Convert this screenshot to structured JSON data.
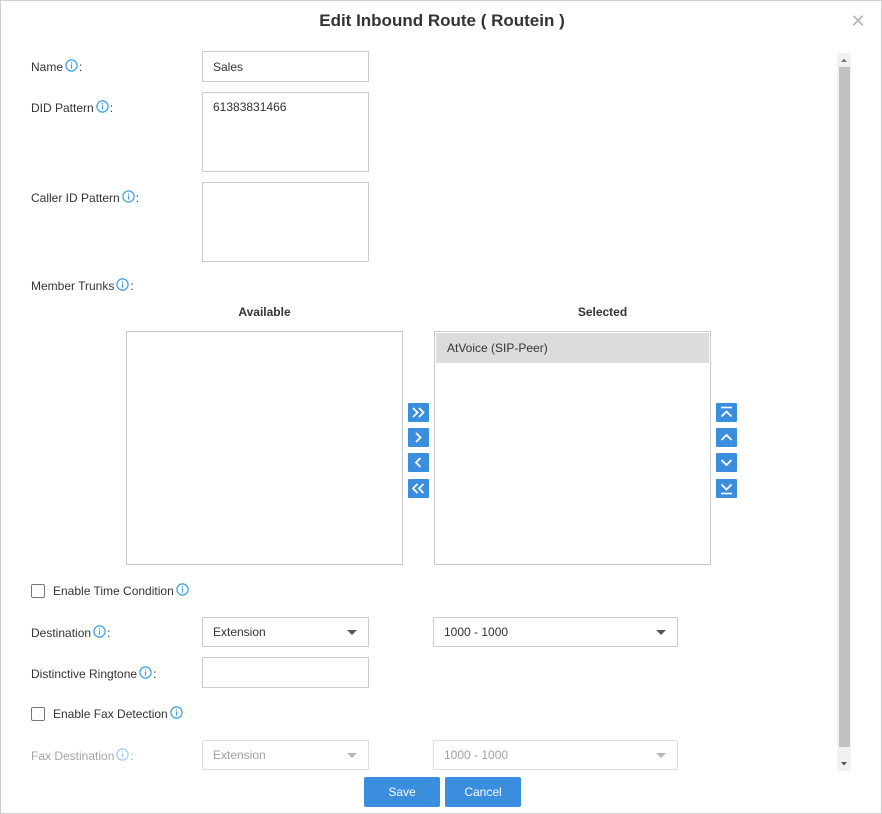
{
  "dialog": {
    "title": "Edit Inbound Route ( Routein )",
    "close_icon": "close-icon"
  },
  "form": {
    "name": {
      "label": "Name",
      "colon": ":",
      "value": "Sales"
    },
    "did_pattern": {
      "label": "DID Pattern",
      "colon": ":",
      "value": "61383831466"
    },
    "caller_id_pattern": {
      "label": "Caller ID Pattern",
      "colon": ":",
      "value": ""
    },
    "member_trunks": {
      "label": "Member Trunks",
      "colon": ":",
      "available_heading": "Available",
      "selected_heading": "Selected",
      "available_items": [],
      "selected_items": [
        "AtVoice (SIP-Peer)"
      ],
      "transfer_buttons": [
        "add-all-icon",
        "add-icon",
        "remove-icon",
        "remove-all-icon"
      ],
      "order_buttons": [
        "move-top-icon",
        "move-up-icon",
        "move-down-icon",
        "move-bottom-icon"
      ]
    },
    "enable_time_condition": {
      "label": "Enable Time Condition",
      "checked": false
    },
    "destination": {
      "label": "Destination",
      "colon": ":",
      "type_value": "Extension",
      "target_value": "1000 - 1000"
    },
    "distinctive_ringtone": {
      "label": "Distinctive Ringtone",
      "colon": ":",
      "value": ""
    },
    "enable_fax_detection": {
      "label": "Enable Fax Detection",
      "checked": false
    },
    "fax_destination": {
      "label": "Fax Destination",
      "colon": ":",
      "type_value": "Extension",
      "target_value": "1000 - 1000",
      "disabled": true
    }
  },
  "footer": {
    "save_label": "Save",
    "cancel_label": "Cancel"
  },
  "colors": {
    "accent": "#3b8ede",
    "info_icon": "#3b9ee0",
    "text": "#333333",
    "disabled_text": "#a5a5a5"
  }
}
